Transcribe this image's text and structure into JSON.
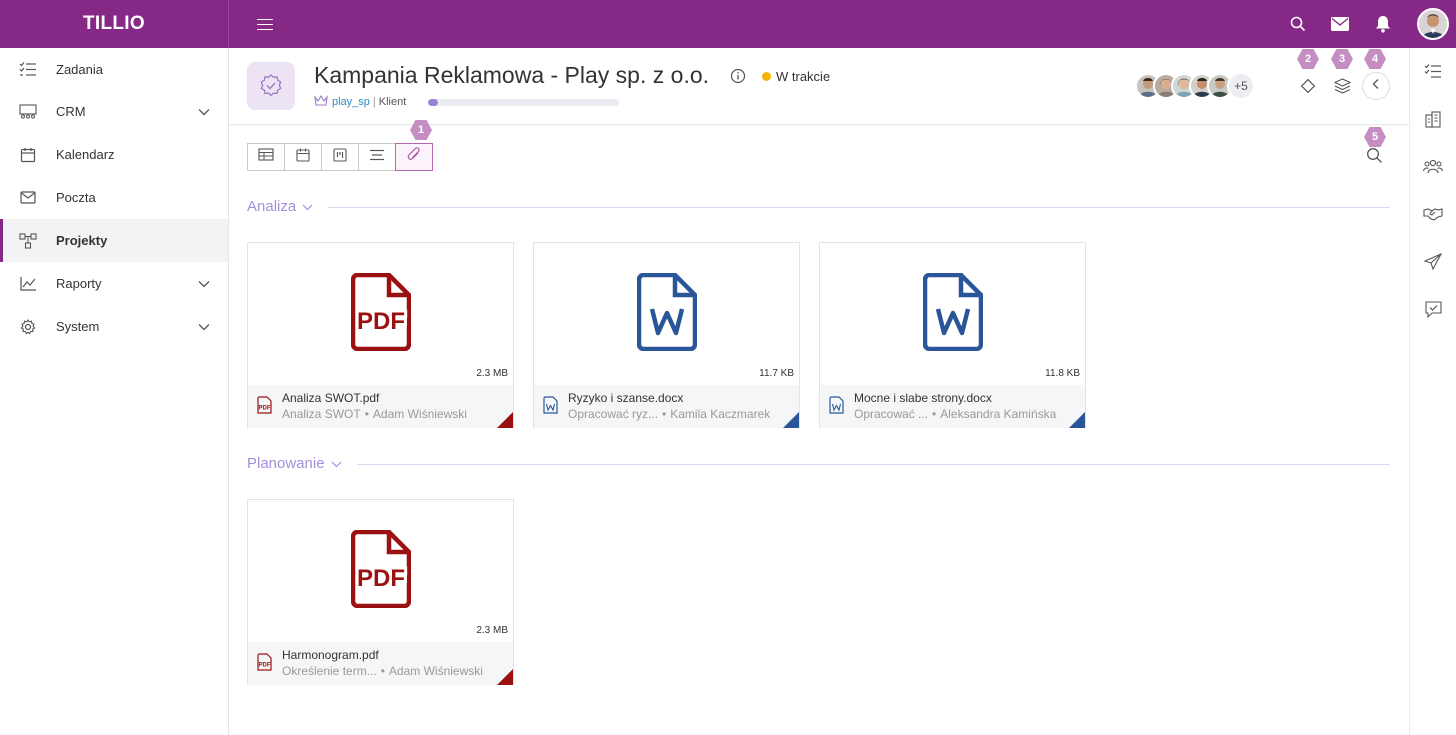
{
  "app": {
    "brand": "TILLIO"
  },
  "sidebar": {
    "items": [
      {
        "label": "Zadania",
        "icon": "tasks-icon",
        "expandable": false,
        "active": false
      },
      {
        "label": "CRM",
        "icon": "crm-icon",
        "expandable": true,
        "active": false
      },
      {
        "label": "Kalendarz",
        "icon": "calendar-icon",
        "expandable": false,
        "active": false
      },
      {
        "label": "Poczta",
        "icon": "mail-icon",
        "expandable": false,
        "active": false
      },
      {
        "label": "Projekty",
        "icon": "projects-icon",
        "expandable": false,
        "active": true
      },
      {
        "label": "Raporty",
        "icon": "chart-icon",
        "expandable": true,
        "active": false
      },
      {
        "label": "System",
        "icon": "gear-icon",
        "expandable": true,
        "active": false
      }
    ]
  },
  "project": {
    "title": "Kampania Reklamowa - Play sp. z o.o.",
    "status": "W trakcie",
    "status_color": "#f5b400",
    "client_login": "play_sp",
    "client_role": "Klient",
    "progress": 0.05,
    "members_extra": "+5"
  },
  "badges": [
    "1",
    "2",
    "3",
    "4",
    "5"
  ],
  "sections": [
    {
      "title": "Analiza",
      "files": [
        {
          "name": "Analiza SWOT.pdf",
          "task": "Analiza SWOT",
          "author": "Adam Wiśniewski",
          "size": "2.3 MB",
          "type": "pdf"
        },
        {
          "name": "Ryzyko i szanse.docx",
          "task": "Opracować ryz...",
          "author": "Kamila Kaczmarek",
          "size": "11.7 KB",
          "type": "docx"
        },
        {
          "name": "Mocne i slabe strony.docx",
          "task": "Opracować ...",
          "author": "Aleksandra Kamińska",
          "size": "11.8 KB",
          "type": "docx"
        }
      ]
    },
    {
      "title": "Planowanie",
      "files": [
        {
          "name": "Harmonogram.pdf",
          "task": "Określenie term...",
          "author": "Adam Wiśniewski",
          "size": "2.3 MB",
          "type": "pdf"
        }
      ]
    }
  ],
  "colors": {
    "brand": "#862886",
    "pdf": "#9b1111",
    "docx": "#2a5699",
    "accent": "#a58fdc"
  }
}
